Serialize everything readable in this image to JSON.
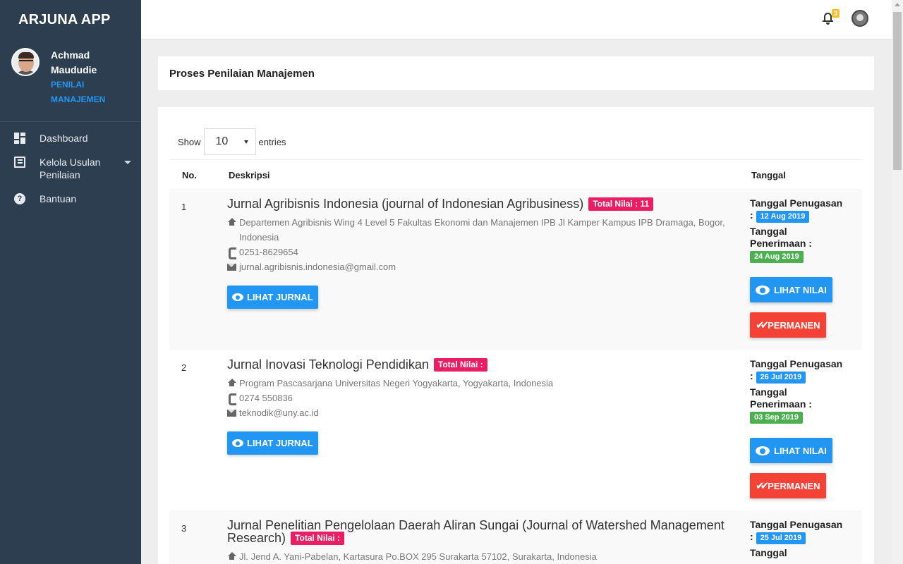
{
  "app": {
    "brand": "ARJUNA APP"
  },
  "user": {
    "name": "Achmad Maududie",
    "role": "PENILAI MANAJEMEN"
  },
  "sidebar": {
    "items": [
      {
        "label": "Dashboard",
        "icon": "dashboard-icon"
      },
      {
        "label": "Kelola Usulan Penilaian",
        "icon": "book-icon"
      },
      {
        "label": "Bantuan",
        "icon": "help-icon"
      }
    ]
  },
  "topbar": {
    "notification_count": "3"
  },
  "page": {
    "title": "Proses Penilaian Manajemen"
  },
  "table": {
    "show_label": "Show",
    "entries_value": "10",
    "entries_label": "entries",
    "headers": {
      "no": "No.",
      "desc": "Deskripsi",
      "tanggal": "Tanggal"
    },
    "labels": {
      "total_nilai": "Total Nilai :",
      "lihat_jurnal": "LIHAT JURNAL",
      "lihat_nilai": "LIHAT NILAI",
      "permanen": "PERMANEN",
      "tanggal_penugasan": "Tanggal Penugasan",
      "tanggal_penerimaan": "Tanggal Penerimaan",
      "colon": ":"
    },
    "rows": [
      {
        "no": "1",
        "title": "Jurnal Agribisnis Indonesia (journal of Indonesian Agribusiness)",
        "total_nilai": "Total Nilai : 11",
        "address": "Departemen Agribisnis Wing 4 Level 5 Fakultas Ekonomi dan Manajemen IPB Jl Kamper Kampus IPB Dramaga, Bogor, Indonesia",
        "phone": "0251-8629654",
        "email": "jurnal.agribisnis.indonesia@gmail.com",
        "tanggal_penugasan": "12 Aug 2019",
        "tanggal_penerimaan": "24 Aug 2019"
      },
      {
        "no": "2",
        "title": "Jurnal Inovasi Teknologi Pendidikan",
        "total_nilai": "Total Nilai :",
        "address": "Program Pascasarjana Universitas Negeri Yogyakarta, Yogyakarta, Indonesia",
        "phone": "0274 550836",
        "email": "teknodik@uny.ac.id",
        "tanggal_penugasan": "26 Jul 2019",
        "tanggal_penerimaan": "03 Sep 2019"
      },
      {
        "no": "3",
        "title": "Jurnal Penelitian Pengelolaan Daerah Aliran Sungai (Journal of Watershed Management Research)",
        "total_nilai": "Total Nilai :",
        "address": "Jl. Jend A. Yani-Pabelan, Kartasura Po.BOX 295 Surakarta 57102, Surakarta, Indonesia",
        "tanggal_penugasan": "25 Jul 2019",
        "tanggal_penerimaan_label_partial": "Tanggal"
      }
    ]
  },
  "colors": {
    "sidebar": "#2d3e50",
    "primary": "#2196f3",
    "danger": "#f44336",
    "success": "#4caf50",
    "pink": "#e91e63",
    "notif": "#fbc02d"
  }
}
